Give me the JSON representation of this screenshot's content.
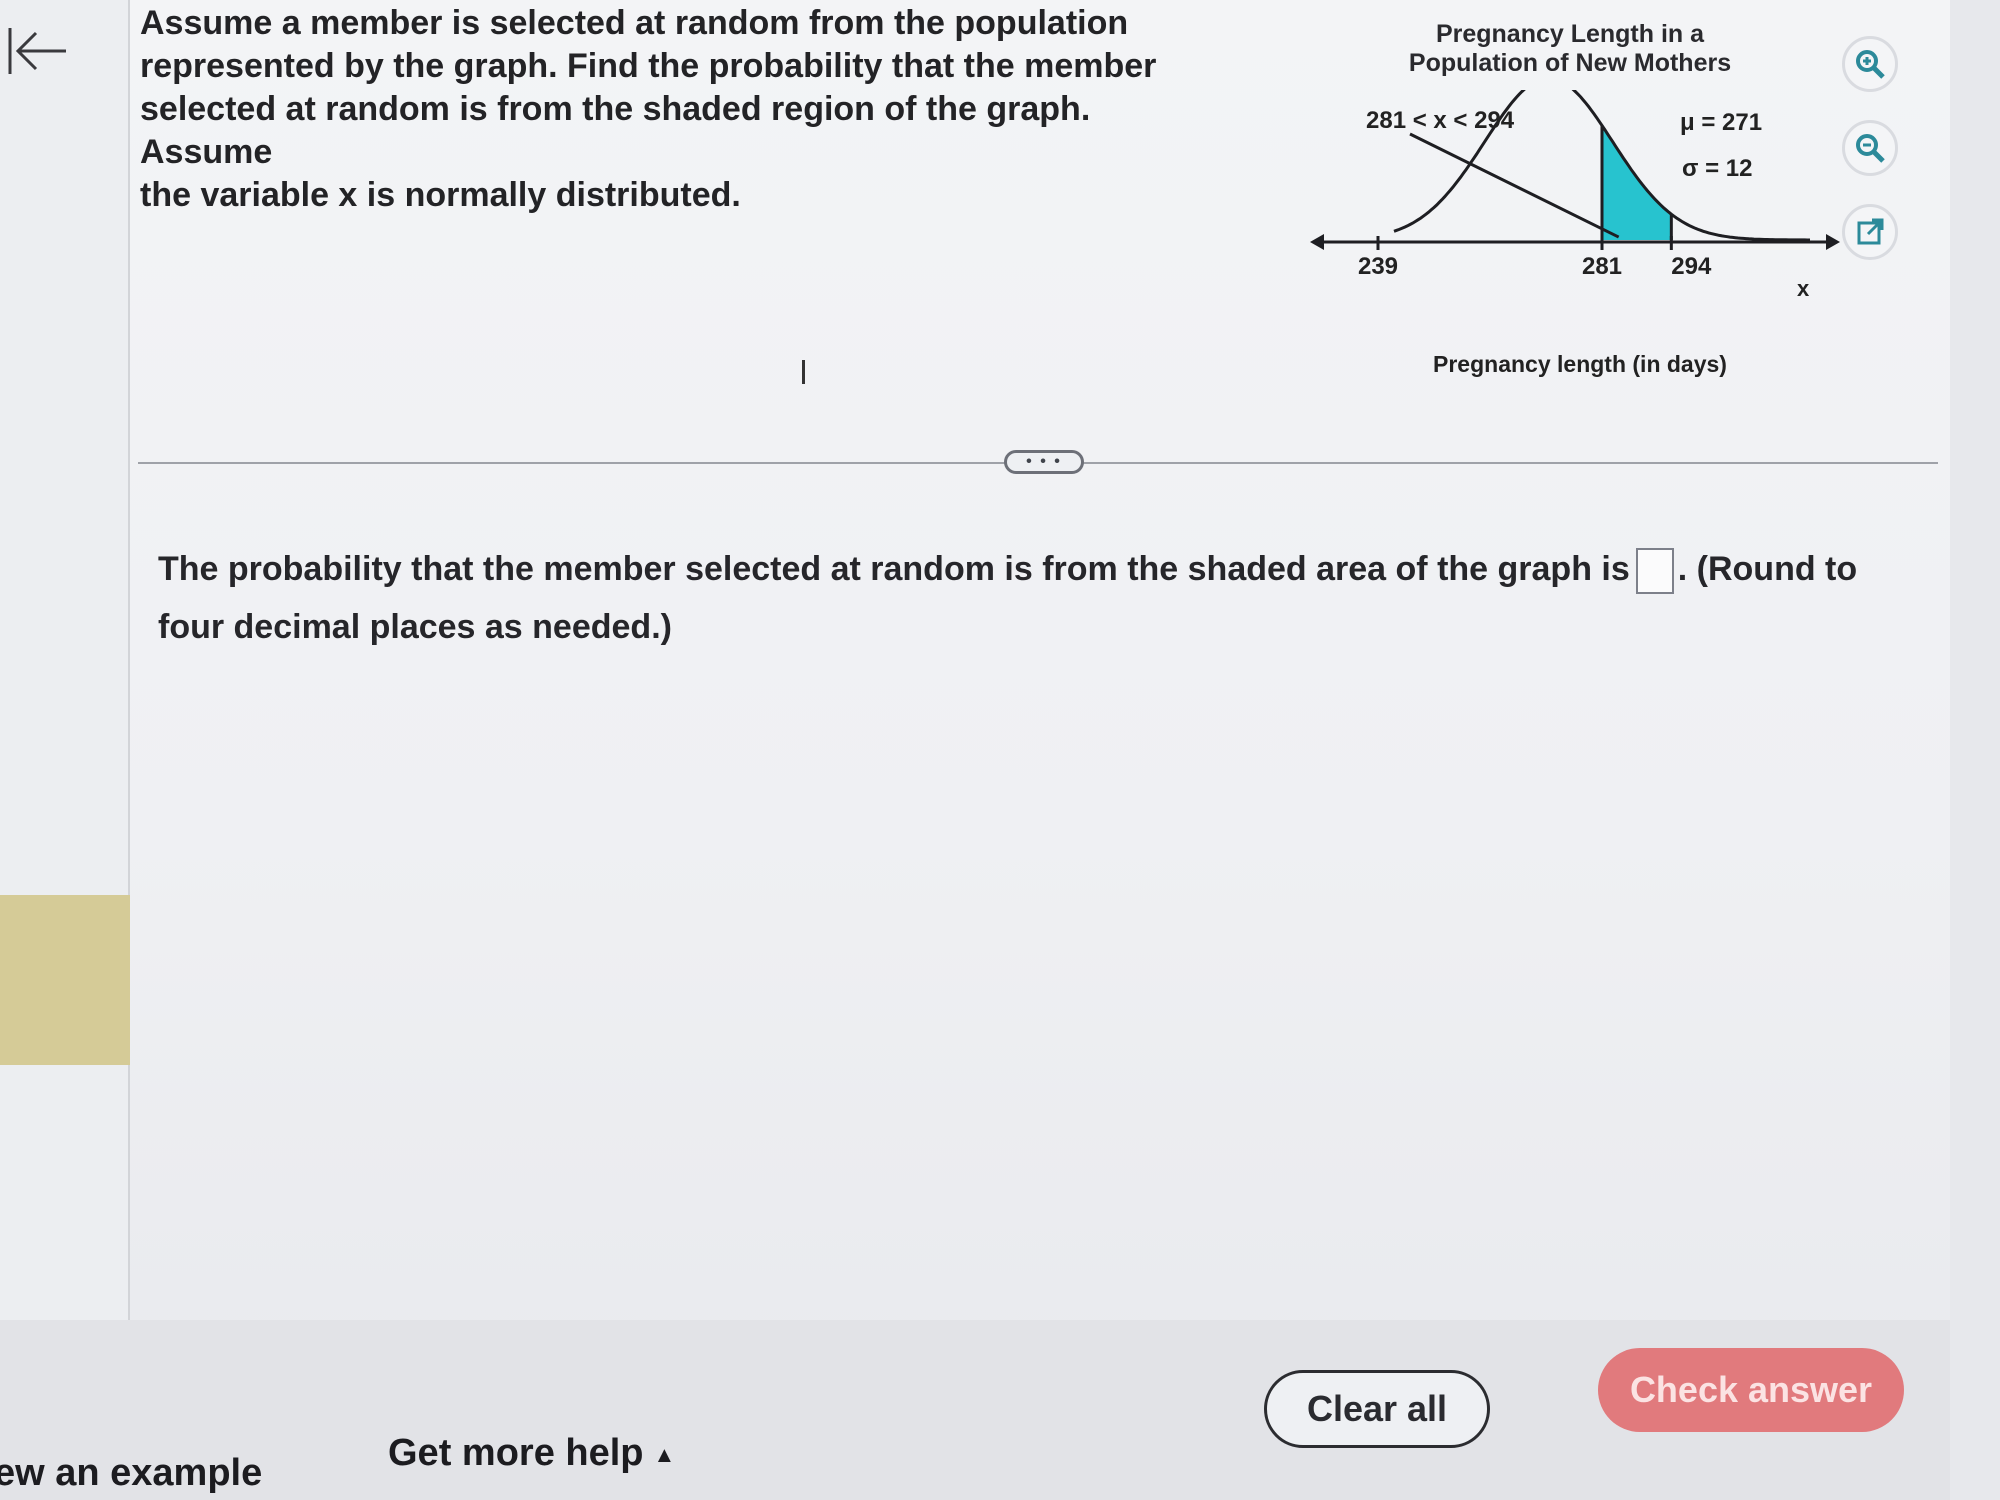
{
  "question": {
    "lines": [
      "Assume a member is selected at random from the population",
      "represented by the graph. Find the probability that the member",
      "selected at random is from the shaded region of the graph. Assume",
      "the variable x is normally distributed."
    ]
  },
  "figure": {
    "title_line1": "Pregnancy Length in a",
    "title_line2": "Population of New Mothers",
    "region_label": "281 < x < 294",
    "mu_label": "μ = 271",
    "sigma_label": "σ = 12",
    "x_axis_symbol": "x",
    "tick_labels": [
      "239",
      "281",
      "294"
    ],
    "xlabel": "Pregnancy length (in days)",
    "shade_color": "#27c3cf"
  },
  "chart_data": {
    "type": "area",
    "title": "Pregnancy Length in a Population of New Mothers",
    "xlabel": "Pregnancy length (in days)",
    "ylabel": "",
    "distribution": "normal",
    "mean": 271,
    "std": 12,
    "xlim": [
      230,
      320
    ],
    "x_ticks": [
      239,
      281,
      294
    ],
    "shaded_region": [
      281,
      294
    ],
    "annotation": "281 < x < 294"
  },
  "tools": {
    "zoom_in_icon": "zoom-in-icon",
    "zoom_out_icon": "zoom-out-icon",
    "popout_icon": "external-link-icon"
  },
  "answer": {
    "prefix": "The probability that the member selected at random is from the shaded area of the graph is",
    "value": "",
    "suffix": ". (Round to four decimal places as needed.)"
  },
  "footer": {
    "example_label": "ew an example",
    "help_label": "Get more help",
    "help_caret": "▲",
    "clear_label": "Clear all",
    "check_label": "Check answer"
  }
}
